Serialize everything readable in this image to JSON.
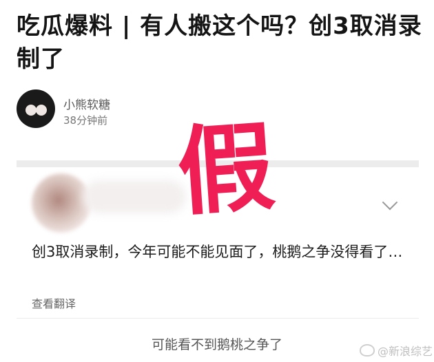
{
  "article": {
    "title": "吃瓜爆料 | 有人搬这个吗？创3取消录制了"
  },
  "author": {
    "name": "小熊软糖",
    "time": "38分钟前"
  },
  "stamp": {
    "text": "假",
    "color": "#ef1f56"
  },
  "post": {
    "body": "创3取消录制，今年可能不能见面了，桃鹅之争没得看了…",
    "translate_label": "查看翻译"
  },
  "caption": "可能看不到鹅桃之争了",
  "watermark": "@新浪综艺"
}
